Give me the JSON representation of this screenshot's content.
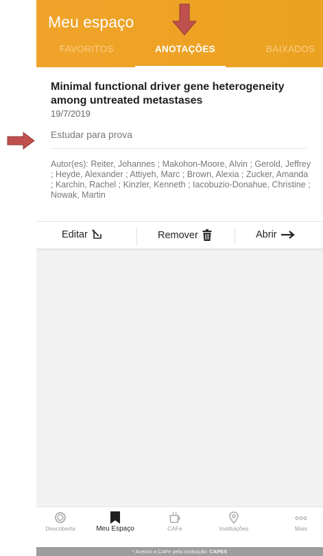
{
  "header": {
    "title": "Meu espaço"
  },
  "tabs": [
    {
      "label": "FAVORITOS"
    },
    {
      "label": "ANOTAÇÕES"
    },
    {
      "label": "BAIXADOS"
    }
  ],
  "card": {
    "title": "Minimal functional driver gene heterogeneity among untreated metastases",
    "date": "19/7/2019",
    "note": "Estudar para prova",
    "authors": "Autor(es): Reiter, Johannes ; Makohon-Moore, Alvin ; Gerold, Jeffrey ; Heyde, Alexander ; Attiyeh, Marc ; Brown, Alexia ; Zucker, Amanda ; Karchin, Rachel ; Kinzler, Kenneth ; Iacobuzio-Donahue, Christine ; Nowak, Martin"
  },
  "actions": {
    "edit": "Editar",
    "remove": "Remover",
    "open": "Abrir"
  },
  "nav": [
    {
      "label": "Descoberta",
      "icon": "discovery-icon"
    },
    {
      "label": "Meu Espaço",
      "icon": "bookmark-icon"
    },
    {
      "label": "CAFe",
      "icon": "cafe-icon"
    },
    {
      "label": "Instituições",
      "icon": "location-pin-icon"
    },
    {
      "label": "Mais",
      "icon": "more-icon"
    }
  ],
  "footer": {
    "text": "* Acesso a CAFe pela instituição:",
    "institution": "CAPES"
  },
  "colors": {
    "accent": "#F0A32A",
    "annotation_arrow": "#C0504D"
  }
}
